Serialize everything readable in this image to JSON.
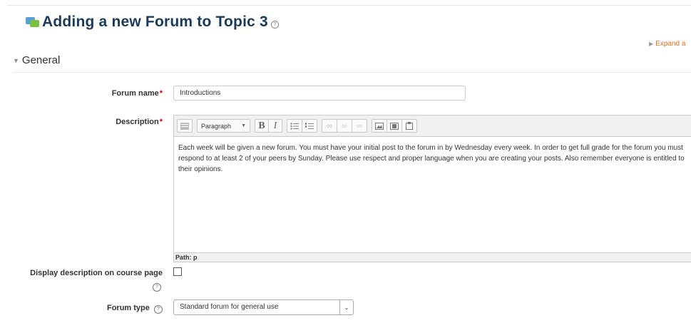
{
  "page": {
    "title": "Adding a new Forum to Topic 3",
    "expand_all": "Expand a"
  },
  "section": {
    "title": "General"
  },
  "form": {
    "forum_name": {
      "label": "Forum name",
      "value": "Introductions",
      "required_mark": "*"
    },
    "description": {
      "label": "Description",
      "required_mark": "*",
      "toolbar": {
        "format_select": "Paragraph",
        "bold": "B",
        "italic": "I"
      },
      "content": "Each week will be given a new forum. You must have your initial post to the forum in by Wednesday every week. In order to get full grade for the forum you must respond to at least 2 of your peers by Sunday. Please use respect and proper language when you are creating your posts. Also remember everyone is entitled to their opinions.",
      "path": "Path: p"
    },
    "display_description": {
      "label": "Display description on course page",
      "checked": false
    },
    "forum_type": {
      "label": "Forum type",
      "value": "Standard forum for general use"
    }
  },
  "icons": {
    "page_icon": "forum-icon",
    "help": "help-icon"
  }
}
